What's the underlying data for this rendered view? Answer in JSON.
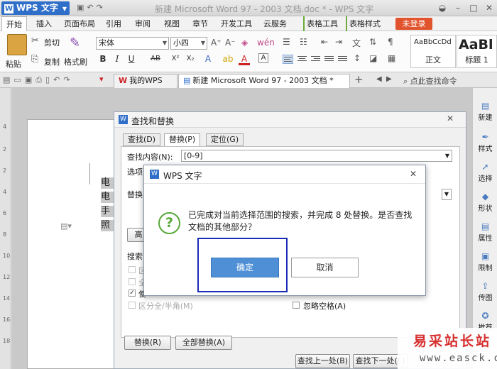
{
  "titlebar": {
    "app_button": "WPS 文字",
    "title": "新建 Microsoft Word 97 - 2003 文档.doc * - WPS 文字"
  },
  "menu": {
    "tabs": [
      "开始",
      "插入",
      "页面布局",
      "引用",
      "审阅",
      "视图",
      "章节",
      "开发工具",
      "云服务",
      "表格工具",
      "表格样式"
    ],
    "login": "未登录"
  },
  "ribbon": {
    "cut": "剪切",
    "paste": "粘贴",
    "copy": "复制",
    "format_painter": "格式刷",
    "font": "宋体",
    "size": "小四",
    "style_normal_sample": "AaBbCcDd",
    "style_normal": "正文",
    "style_heading_sample": "AaBl",
    "style_heading": "标题 1"
  },
  "doctabs": {
    "my_wps": "我的WPS",
    "new_doc": "新建 Microsoft Word 97 - 2003 文档 *",
    "search_cmd": "点此查找命令"
  },
  "document": {
    "lines": [
      "电",
      "电",
      "手",
      "照"
    ]
  },
  "sidebar": [
    "新建",
    "样式",
    "选择",
    "形状",
    "属性",
    "限制",
    "传图",
    "推荐"
  ],
  "find_replace": {
    "title": "查找和替换",
    "tabs": [
      "查找(D)",
      "替换(P)",
      "定位(G)"
    ],
    "find_label": "查找内容(N):",
    "find_value": "[0-9]",
    "options_label": "选项",
    "replace_label": "替换",
    "more_btn": "高",
    "search_label": "搜索",
    "cb_zone": "区",
    "cb_full": "全",
    "cb_wild": "使",
    "cb_halfwidth": "区分全/半角(M)",
    "cb_ignore_space": "忽略空格(A)",
    "replace_btn": "替换(R)",
    "replace_all_btn": "全部替换(A)",
    "find_prev_btn": "查找上一处(B)",
    "find_next_btn": "查找下一处(F)"
  },
  "message": {
    "title": "WPS 文字",
    "icon": "question-icon",
    "text": "已完成对当前选择范围的搜索，并完成 8 处替换。是否查找文档的其他部分？",
    "ok": "确定",
    "cancel": "取消"
  },
  "watermark": {
    "cn": "易采站长站",
    "url": "www.easck.com"
  },
  "colors": {
    "wps_blue": "#2f6fc9",
    "ok_blue": "#4e8fd6",
    "highlight": "#1b2ab5",
    "login_red": "#e1532c",
    "question_green": "#58a83a",
    "watermark_red": "#d62f2f"
  }
}
